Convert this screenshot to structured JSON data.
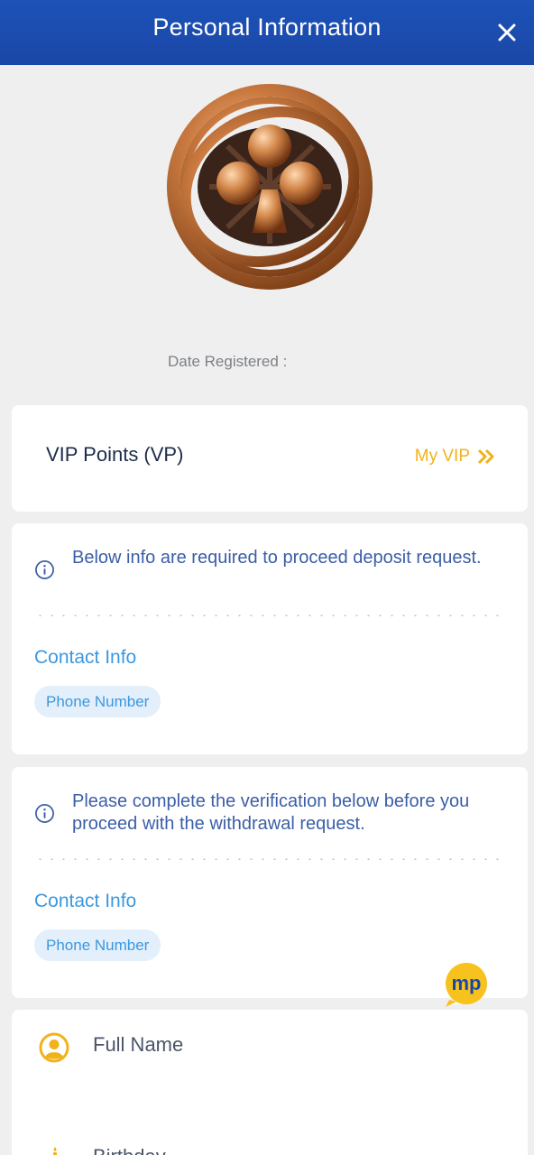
{
  "header": {
    "title": "Personal Information"
  },
  "profile": {
    "date_registered_label": "Date Registered :"
  },
  "vip": {
    "label": "VIP Points (VP)",
    "link_label": "My VIP"
  },
  "deposit_section": {
    "notice": "Below info are required to proceed deposit request.",
    "contact_title": "Contact Info",
    "phone_chip": "Phone Number"
  },
  "withdrawal_section": {
    "notice": "Please complete the verification below before you proceed with the withdrawal request.",
    "contact_title": "Contact Info",
    "phone_chip": "Phone Number"
  },
  "details": {
    "full_name_label": "Full Name",
    "birthday_label": "Birthday"
  },
  "chat_widget": {
    "label": "mp"
  },
  "colors": {
    "header": "#1d52b8",
    "accent_gold": "#f2b21b",
    "link_blue": "#3b98e0",
    "notice_blue": "#3b5ea7"
  }
}
